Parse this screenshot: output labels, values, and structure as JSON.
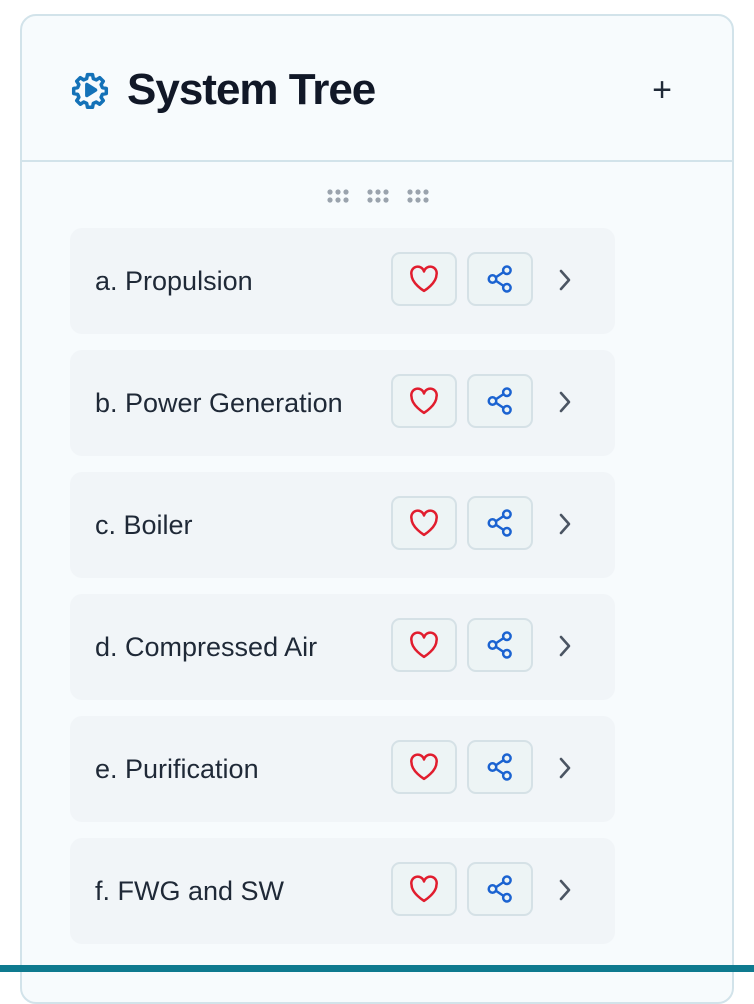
{
  "panel": {
    "title": "System Tree",
    "title_icon": "gear-play-icon",
    "add_icon_glyph": "+",
    "drag_handle_icon": "grip-dots-icon"
  },
  "systems": [
    {
      "label": "a. Propulsion"
    },
    {
      "label": "b. Power Generation"
    },
    {
      "label": "c. Boiler"
    },
    {
      "label": "d. Compressed Air"
    },
    {
      "label": "e. Purification"
    },
    {
      "label": "f. FWG and SW"
    }
  ],
  "row_icons": {
    "favorite": "heart-icon",
    "share": "share-icon",
    "expand": "chevron-right-icon"
  },
  "colors": {
    "accent": "#1472b8",
    "heart": "#e11d2e",
    "share": "#1b63d1",
    "bottom_bar": "#0e7a8f"
  }
}
